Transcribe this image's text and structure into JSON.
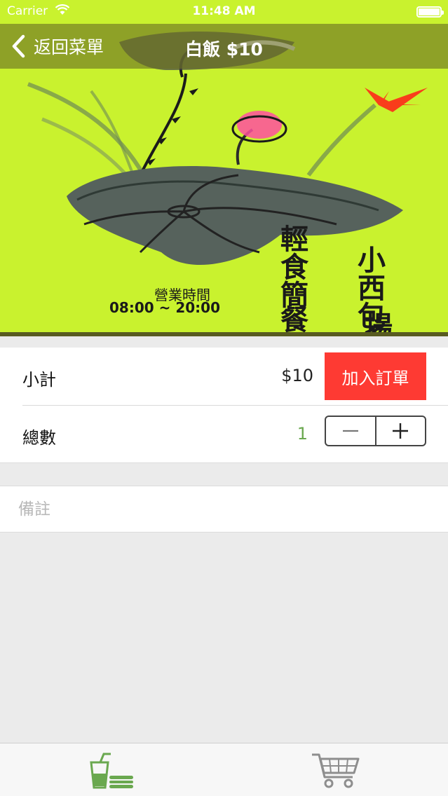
{
  "status_bar": {
    "carrier": "Carrier",
    "time": "11:48 AM"
  },
  "nav": {
    "back_label": "返回菜單",
    "title": "白飯 $10"
  },
  "hero": {
    "title_vertical_1": "小西包場",
    "title_vertical_2": "輕食簡餐",
    "hours_label": "營業時間",
    "hours": "08:00 ~ 20:00"
  },
  "order": {
    "subtotal_label": "小計",
    "subtotal_value": "$10",
    "add_button_label": "加入訂單",
    "quantity_label": "總數",
    "quantity_value": "1",
    "minus_symbol": "−",
    "plus_symbol": "+"
  },
  "note": {
    "placeholder": "備註"
  },
  "tab_bar": {
    "items": [
      {
        "icon": "food-drink-icon",
        "selected": true,
        "color": "#6aa84f"
      },
      {
        "icon": "shopping-cart-icon",
        "selected": false,
        "color": "#8e8e8e"
      }
    ]
  },
  "colors": {
    "hero_background": "#c9f22e",
    "nav_overlay": "#6b7023",
    "add_button": "#fe3a33",
    "quantity_text": "#6aa84f",
    "background": "#ebebeb"
  }
}
